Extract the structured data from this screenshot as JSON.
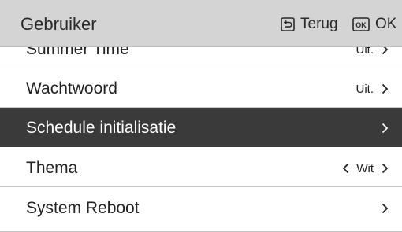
{
  "header": {
    "title": "Gebruiker",
    "back_label": "Terug",
    "ok_label": "OK",
    "ok_icon_text": "OK"
  },
  "menu": {
    "items": [
      {
        "label": "Summer Time",
        "value": "Uit.",
        "selected": false
      },
      {
        "label": "Wachtwoord",
        "value": "Uit.",
        "selected": false
      },
      {
        "label": "Schedule initialisatie",
        "value": "",
        "selected": true
      },
      {
        "label": "Thema",
        "value": "Wit",
        "selected": false
      },
      {
        "label": "System Reboot",
        "value": "",
        "selected": false
      }
    ]
  }
}
